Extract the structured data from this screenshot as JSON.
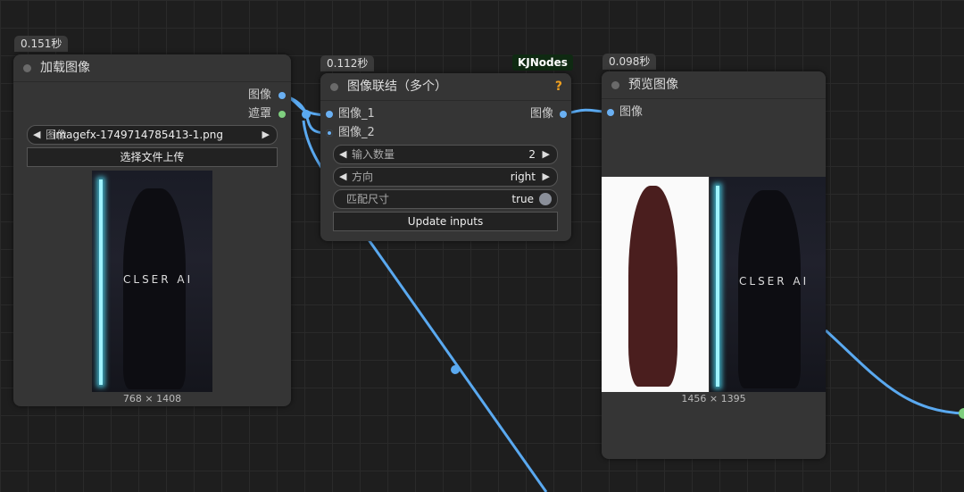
{
  "timings": {
    "load": "0.151秒",
    "concat": "0.112秒",
    "preview": "0.098秒"
  },
  "badge": "KJNodes",
  "load_node": {
    "title": "加载图像",
    "outputs": [
      {
        "label": "图像",
        "color": "#6ab0f3"
      },
      {
        "label": "遮罩",
        "color": "#7fcf7f"
      }
    ],
    "image_widget": {
      "label": "图像",
      "value": "imagefx-1749714785413-1.png"
    },
    "upload_button": "选择文件上传",
    "image_size": "768 × 1408",
    "watermark": "CLSER AI"
  },
  "concat_node": {
    "title": "图像联结（多个）",
    "help": "?",
    "inputs": [
      "图像_1",
      "图像_2"
    ],
    "output": "图像",
    "widgets": [
      {
        "label": "输入数量",
        "value": "2"
      },
      {
        "label": "方向",
        "value": "right"
      },
      {
        "label": "匹配尺寸",
        "value": "true"
      }
    ],
    "update_button": "Update inputs"
  },
  "preview_node": {
    "title": "预览图像",
    "input": "图像",
    "image_size": "1456 × 1395",
    "watermark": "CLSER AI"
  },
  "colors": {
    "wire": "#5aa9f0",
    "node_bg": "#353535",
    "canvas_bg": "#1e1e1e"
  }
}
